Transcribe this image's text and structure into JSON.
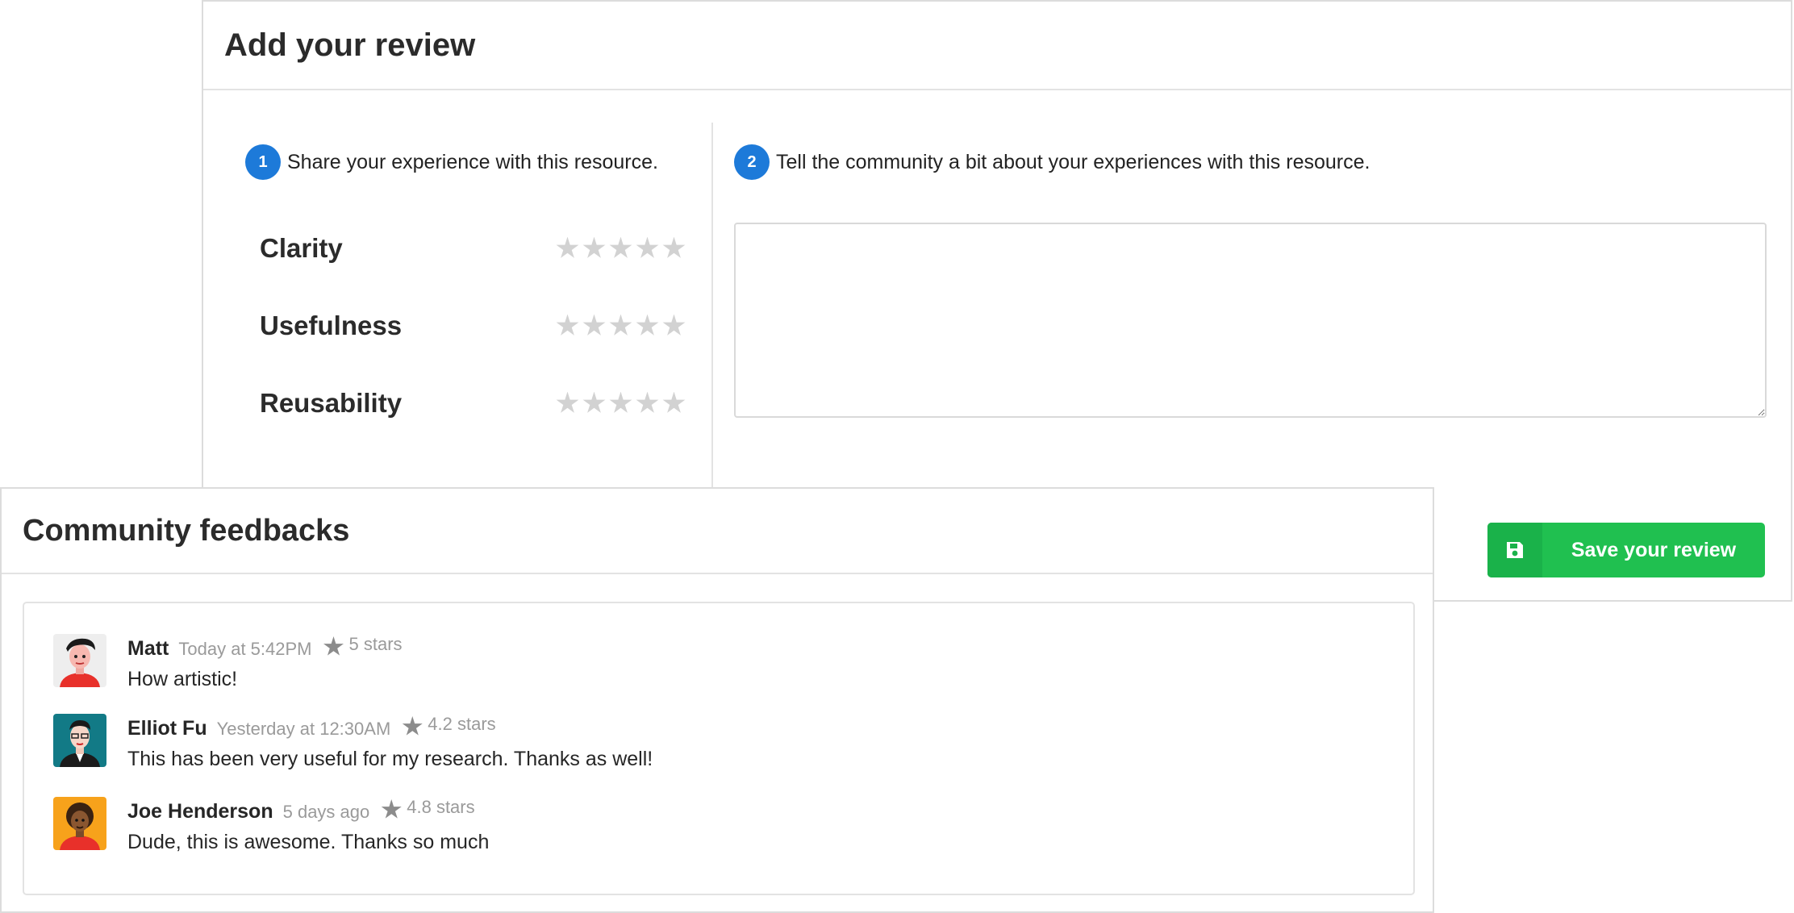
{
  "review": {
    "title": "Add your review",
    "step1": {
      "number": "1",
      "text": "Share your experience with this resource."
    },
    "step2": {
      "number": "2",
      "text": "Tell the community a bit about your experiences with this resource."
    },
    "criteria": [
      {
        "label": "Clarity",
        "rating": 0,
        "max": 5
      },
      {
        "label": "Usefulness",
        "rating": 0,
        "max": 5
      },
      {
        "label": "Reusability",
        "rating": 0,
        "max": 5
      }
    ],
    "textarea_value": "",
    "save_label": "Save your review",
    "save_icon": "floppy-disk-icon"
  },
  "feedback": {
    "title": "Community feedbacks",
    "comments": [
      {
        "author": "Matt",
        "time": "Today at 5:42PM",
        "rating": "5 stars",
        "text": "How artistic!"
      },
      {
        "author": "Elliot Fu",
        "time": "Yesterday at 12:30AM",
        "rating": "4.2 stars",
        "text": "This has been very useful for my research. Thanks as well!"
      },
      {
        "author": "Joe Henderson",
        "time": "5 days ago",
        "rating": "4.8 stars",
        "text": "Dude, this is awesome. Thanks so much"
      }
    ]
  },
  "colors": {
    "step_badge": "#1d7ad9",
    "save_button": "#20c050",
    "star_empty": "#d2d2d2",
    "meta_text": "#9a9a9a"
  }
}
